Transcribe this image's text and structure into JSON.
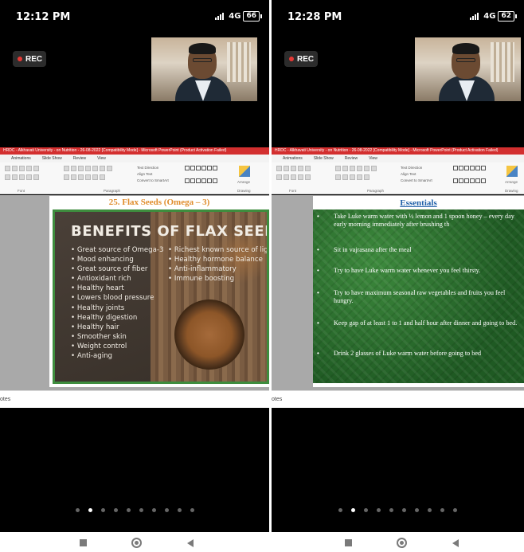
{
  "phones": [
    {
      "time": "12:12 PM",
      "network": "4G",
      "battery": "66",
      "rec_label": "REC",
      "ppt_title": "HRDC - Alkhavati University - on Nutrition - 26-08-2022 [Compatibility Mode] - Microsoft PowerPoint (Product Activation Failed)",
      "menu": [
        "Animations",
        "Slide Show",
        "Review",
        "View"
      ],
      "ribbon": {
        "group1": "Font",
        "group2": "Paragraph",
        "group3": "Drawing",
        "arrange": "Arrange",
        "text_direction": "Text Direction",
        "align_text": "Align Text",
        "convert": "Convert to SmartArt"
      },
      "notes_label": "otes"
    },
    {
      "time": "12:28 PM",
      "network": "4G",
      "battery": "62",
      "rec_label": "REC",
      "ppt_title": "HRDC - Alkhavati University - on Nutrition - 26-08-2022 [Compatibility Mode] - Microsoft PowerPoint (Product Activation Failed)",
      "menu": [
        "Animations",
        "Slide Show",
        "Review",
        "View"
      ],
      "ribbon": {
        "group1": "Font",
        "group2": "Paragraph",
        "group3": "Drawing",
        "arrange": "Arrange",
        "text_direction": "Text Direction",
        "align_text": "Align Text",
        "convert": "Convert to SmartArt"
      },
      "notes_label": "otes"
    }
  ],
  "slide1": {
    "title": "25. Flax Seeds (Omega – 3)",
    "heading": "BENEFITS OF FLAX SEEDS",
    "col_a": [
      "Great source of Omega-3",
      "Mood enhancing",
      "Great source of fiber",
      "Antioxidant rich",
      "Healthy heart",
      "Lowers blood pressure",
      "Healthy joints",
      "Healthy digestion",
      "Healthy hair",
      "Smoother skin",
      "Weight control",
      "Anti-aging"
    ],
    "col_b": [
      "Richest known source of lig",
      "Healthy hormone balance",
      "Anti-inflammatory",
      "Immune boosting"
    ]
  },
  "slide2": {
    "title": "Essentials",
    "items": [
      "Take Luke warm water with ½ lemon and 1 spoon honey – every day early morning immediately after brushing th",
      "Sit in vajrasana  after  the meal",
      "Try to have Luke warm water whenever you feel thirsty.",
      "Try to have maximum seasonal raw vegetables and fruits you feel hungry.",
      "Keep gap of at least 1 to 1 and half hour after dinner and going to bed.",
      "Drink 2 glasses of Luke warm water before going to bed"
    ]
  },
  "pager": {
    "count": 10,
    "active_index": 1
  }
}
